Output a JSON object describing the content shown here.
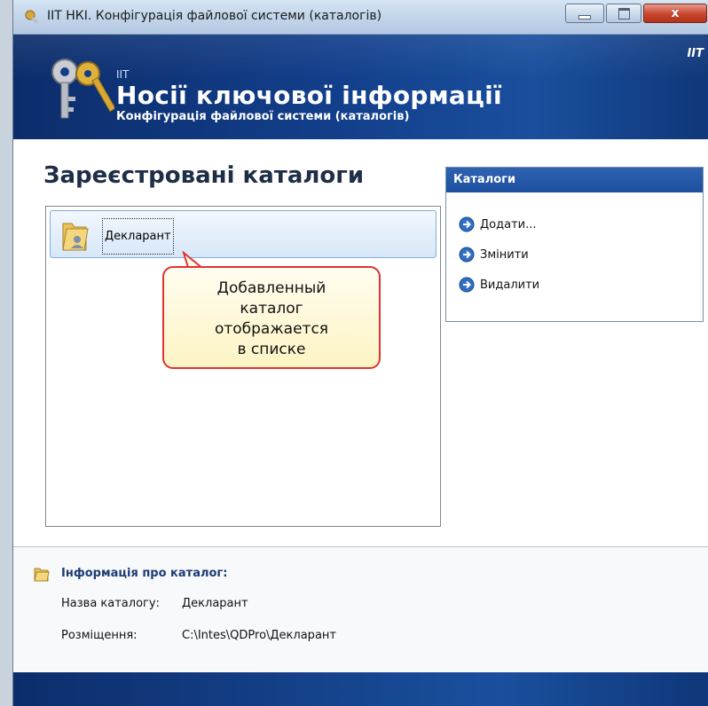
{
  "window": {
    "title": "ІІТ НКІ. Конфігурація файлової системи (каталогів)",
    "close_glyph": "x"
  },
  "banner": {
    "small_label": "IIT",
    "title": "Носії ключової інформації",
    "subtitle": "Конфігурація файлової системи (каталогів)",
    "corner_label": "IIT"
  },
  "main": {
    "section_title": "Зареєстровані каталоги",
    "list_items": [
      {
        "label": "Декларант"
      }
    ]
  },
  "callout": {
    "lines": [
      "Добавленный",
      "каталог",
      "отображается",
      "в списке"
    ]
  },
  "tasks": {
    "header": "Каталоги",
    "items": [
      {
        "label": "Додати..."
      },
      {
        "label": "Змінити"
      },
      {
        "label": "Видалити"
      }
    ]
  },
  "info": {
    "title": "Інформація про каталог:",
    "name_label": "Назва каталогу:",
    "name_value": "Декларант",
    "location_label": "Розміщення:",
    "location_value": "C:\\Intes\\QDPro\\Декларант"
  },
  "colors": {
    "banner": "#123e8a",
    "callout_border": "#dd3333",
    "callout_fill": "#fdf4c4",
    "task_header": "#1c4f9e"
  }
}
